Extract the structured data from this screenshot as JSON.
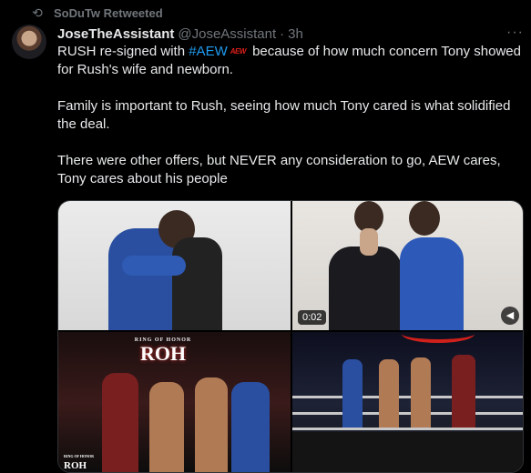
{
  "retweet": {
    "icon": "retweet-icon",
    "label": "SoDuTw Retweeted"
  },
  "tweet": {
    "author_name": "JoseTheAssistant",
    "handle": "@JoseAssistant",
    "separator": "·",
    "time": "3h",
    "more_icon": "more-icon",
    "text": {
      "line1_pre": "RUSH re-signed with ",
      "hashtag": "#AEW",
      "emoji_text": "AEW",
      "line1_post": " because of how much concern Tony showed for Rush's wife and newborn.",
      "para2": "Family is important to Rush, seeing how much Tony cared is what solidified the deal.",
      "para3": "There were other offers, but NEVER any consideration to go, AEW cares, Tony cares about his people"
    },
    "media": {
      "video_duration": "0:02",
      "logo_top": "RING OF HONOR",
      "logo_main": "ROH",
      "corner_top": "RING OF HONOR",
      "corner_main": "ROH"
    }
  },
  "colors": {
    "background": "#000000",
    "text": "#e7e9ea",
    "muted": "#71767b",
    "link": "#1d9bf0",
    "aew_red": "#e0201b"
  }
}
